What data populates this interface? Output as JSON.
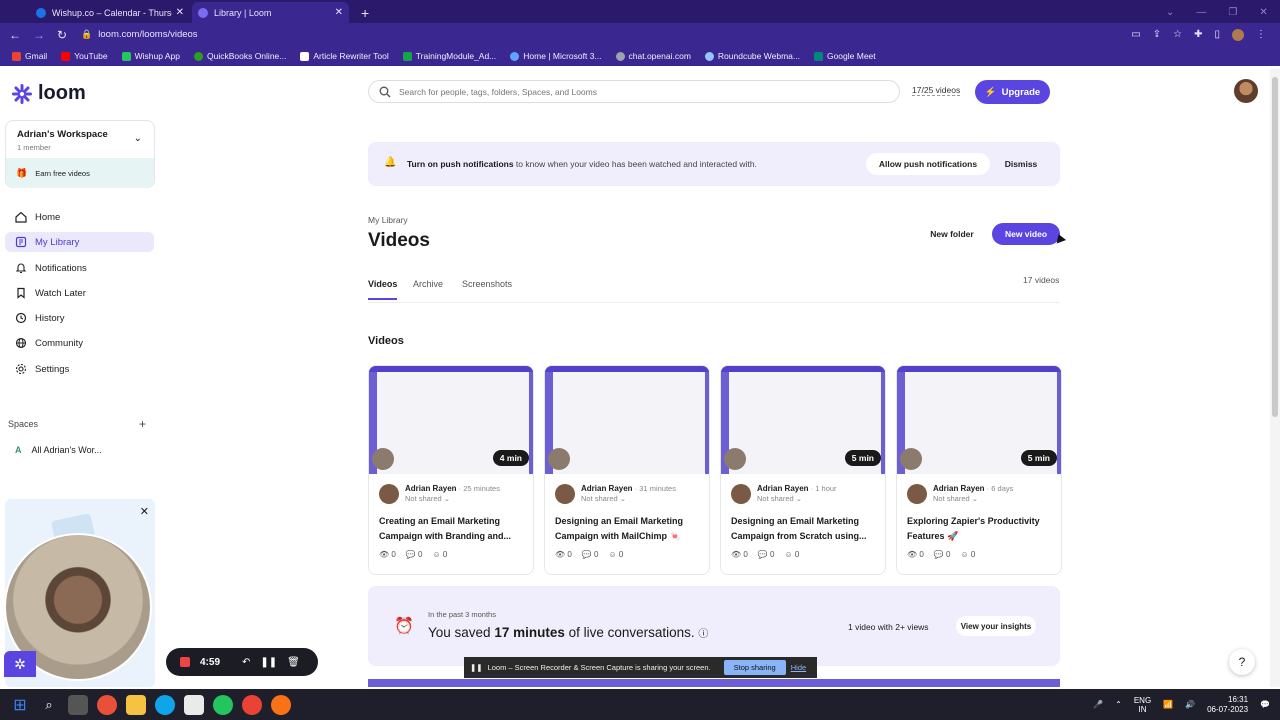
{
  "browser": {
    "tabs": [
      {
        "title": "Wishup.co – Calendar - Thursday"
      },
      {
        "title": "Library | Loom"
      }
    ],
    "url": "loom.com/looms/videos",
    "bookmarks": [
      "Gmail",
      "YouTube",
      "Wishup App",
      "QuickBooks Online...",
      "Article Rewriter Tool",
      "TrainingModule_Ad...",
      "Home | Microsoft 3...",
      "chat.openai.com",
      "Roundcube Webma...",
      "Google Meet"
    ]
  },
  "sidebar": {
    "brand": "loom",
    "workspace_name": "Adrian's Workspace",
    "workspace_members": "1 member",
    "earn_label": "Earn free videos",
    "nav": [
      {
        "label": "Home"
      },
      {
        "label": "My Library"
      },
      {
        "label": "Notifications"
      },
      {
        "label": "Watch Later"
      },
      {
        "label": "History"
      },
      {
        "label": "Community"
      },
      {
        "label": "Settings"
      }
    ],
    "spaces_title": "Spaces",
    "space_item": "All Adrian's Wor...",
    "space_initial": "A"
  },
  "header": {
    "search_placeholder": "Search for people, tags, folders, Spaces, and Looms",
    "video_count": "17/25 videos",
    "upgrade_label": "Upgrade"
  },
  "banner": {
    "bold": "Turn on push notifications",
    "text": " to know when your video has been watched and interacted with.",
    "allow_label": "Allow push notifications",
    "dismiss_label": "Dismiss"
  },
  "library": {
    "breadcrumb": "My Library",
    "title": "Videos",
    "new_folder": "New folder",
    "new_video": "New video",
    "tabs": [
      "Videos",
      "Archive",
      "Screenshots"
    ],
    "count": "17 videos",
    "section_title": "Videos"
  },
  "videos": [
    {
      "duration": "4 min",
      "author": "Adrian Rayen",
      "time": "25 minutes",
      "sharing": "Not shared",
      "title": "Creating an Email Marketing Campaign with Branding and...",
      "views": "0",
      "comments": "0",
      "reactions": "0"
    },
    {
      "duration": "",
      "author": "Adrian Rayen",
      "time": "31 minutes",
      "sharing": "Not shared",
      "title": "Designing an Email Marketing Campaign with MailChimp 🍬",
      "views": "0",
      "comments": "0",
      "reactions": "0"
    },
    {
      "duration": "5 min",
      "author": "Adrian Rayen",
      "time": "1 hour",
      "sharing": "Not shared",
      "title": "Designing an Email Marketing Campaign from Scratch using...",
      "views": "0",
      "comments": "0",
      "reactions": "0"
    },
    {
      "duration": "5 min",
      "author": "Adrian Rayen",
      "time": "6 days",
      "sharing": "Not shared",
      "title": "Exploring Zapier's Productivity Features 🚀",
      "views": "0",
      "comments": "0",
      "reactions": "0"
    }
  ],
  "insights": {
    "period": "In the past 3 months",
    "saved_pre": "You saved ",
    "saved_bold": "17 minutes",
    "saved_post": " of live conversations.",
    "views_text": "1 video with 2+ views",
    "cta": "View your insights"
  },
  "recorder": {
    "timer": "4:59"
  },
  "share_bar": {
    "text": "Loom – Screen Recorder & Screen Capture is sharing your screen.",
    "stop": "Stop sharing",
    "hide": "Hide"
  },
  "taskbar": {
    "lang1": "ENG",
    "lang2": "IN",
    "time": "16:31",
    "date": "06-07-2023"
  },
  "colors": {
    "brand": "#4b3bcf",
    "accent": "#5b45e0",
    "banner": "#f0eefc"
  }
}
